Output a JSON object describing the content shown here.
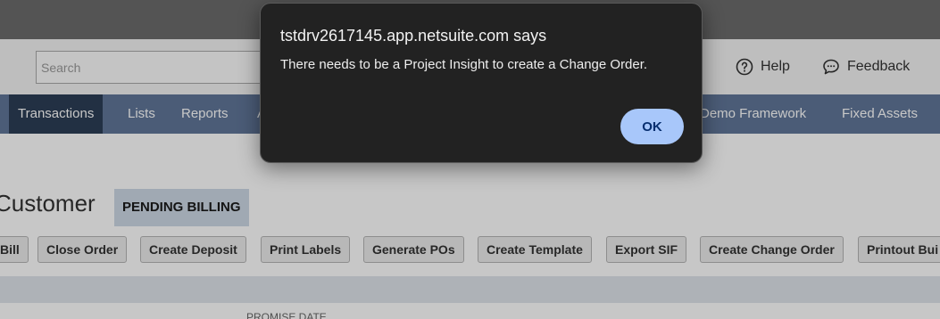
{
  "header": {
    "search": {
      "placeholder": "Search",
      "value": ""
    },
    "help_label": "Help",
    "feedback_label": "Feedback",
    "icons": {
      "help": "question-circle-icon",
      "feedback": "chat-bubble-icon"
    }
  },
  "nav": {
    "items": [
      {
        "label": "Transactions",
        "active": true
      },
      {
        "label": "Lists",
        "active": false
      },
      {
        "label": "Reports",
        "active": false
      },
      {
        "label": "A",
        "active": false
      },
      {
        "label": "Demo Framework",
        "active": false
      },
      {
        "label": "Fixed Assets",
        "active": false
      }
    ]
  },
  "record": {
    "title": "Customer",
    "status": "PENDING BILLING",
    "actions": [
      "Bill",
      "Close Order",
      "Create Deposit",
      "Print Labels",
      "Generate POs",
      "Create Template",
      "Export SIF",
      "Create Change Order",
      "Printout Bui"
    ],
    "field_label": "PROMISE DATE"
  },
  "dialog": {
    "title": "tstdrv2617145.app.netsuite.com says",
    "message": "There needs to be a Project Insight to create a Change Order.",
    "ok_label": "OK"
  },
  "colors": {
    "nav_bg": "#607799",
    "nav_active_bg": "#2c3e57",
    "dialog_bg": "#222222",
    "ok_button_bg": "#a8c7fa",
    "status_badge_bg": "#cdd9e6"
  }
}
